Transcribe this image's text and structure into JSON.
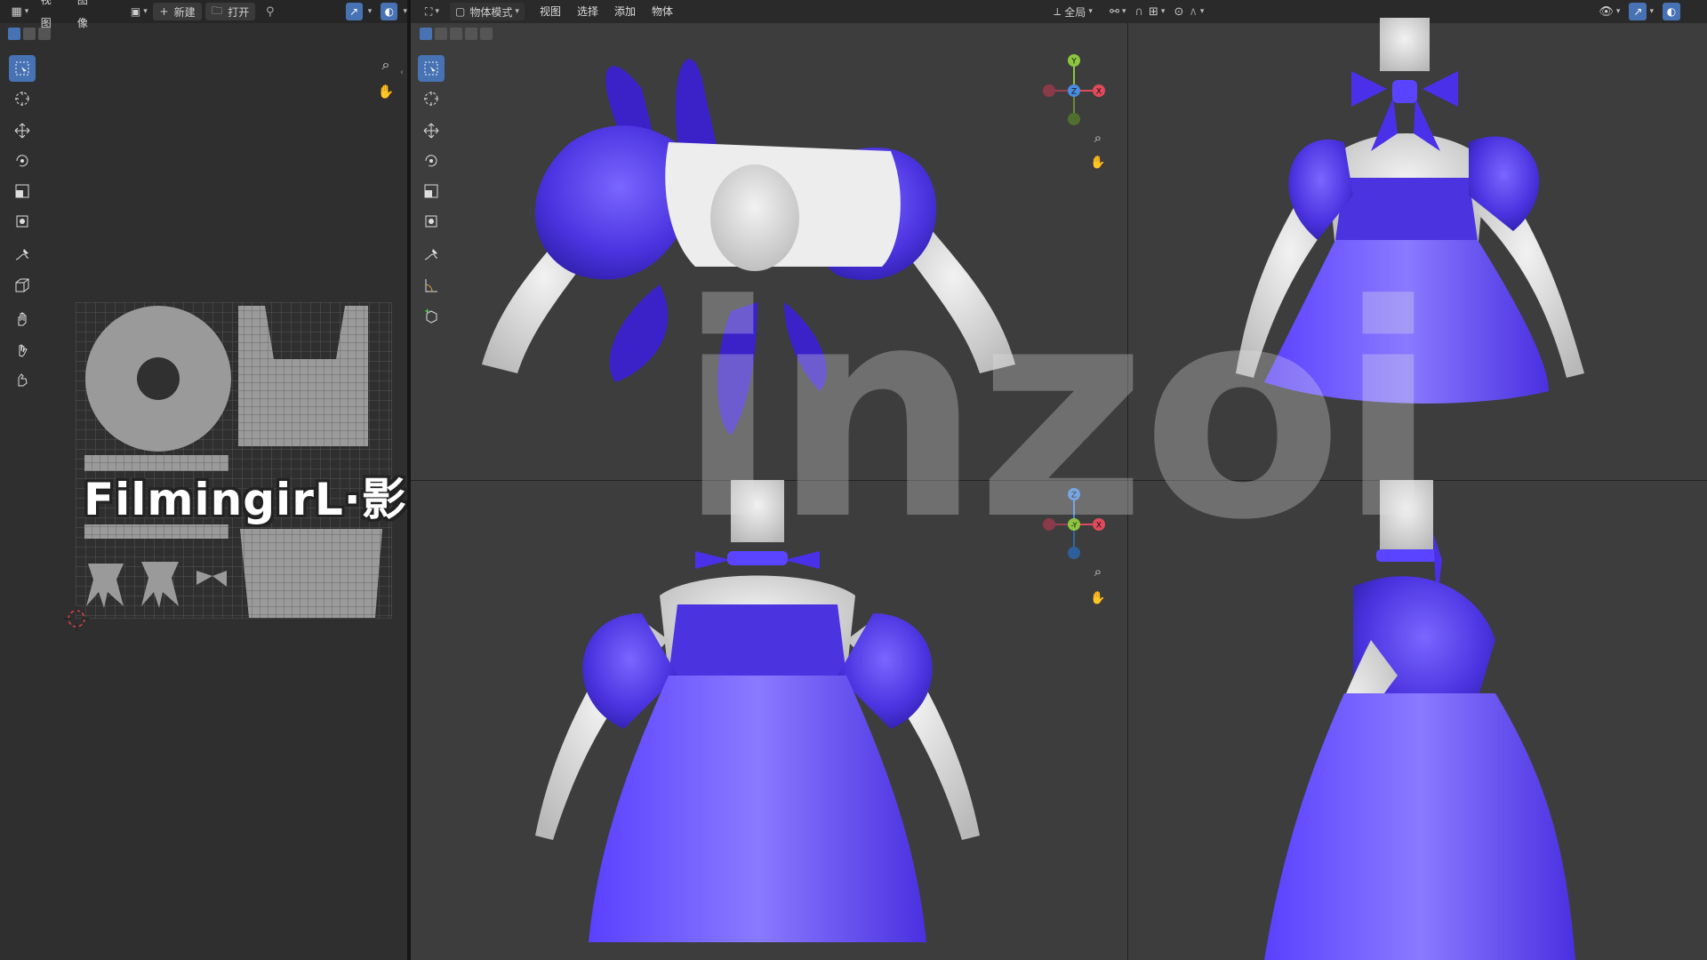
{
  "uv_editor": {
    "header": {
      "menus": [
        "视图",
        "图像"
      ],
      "new_label": "新建",
      "open_label": "打开"
    },
    "overlay_text": "FilmingirL·影"
  },
  "viewport": {
    "header": {
      "mode_label": "物体模式",
      "menus": [
        "视图",
        "选择",
        "添加",
        "物体"
      ],
      "transform_orientation": "全局"
    },
    "gizmo_top": {
      "y": "Y",
      "z": "Z",
      "x": "X"
    },
    "gizmo_front": {
      "z": "Z",
      "y": "-Y",
      "x": "X"
    }
  },
  "watermark": "inzoi",
  "colors": {
    "accent": "#4772b3",
    "dress": "#5a3ff0",
    "mannequin": "#d6d6d6",
    "bg": "#3c3c3c"
  }
}
